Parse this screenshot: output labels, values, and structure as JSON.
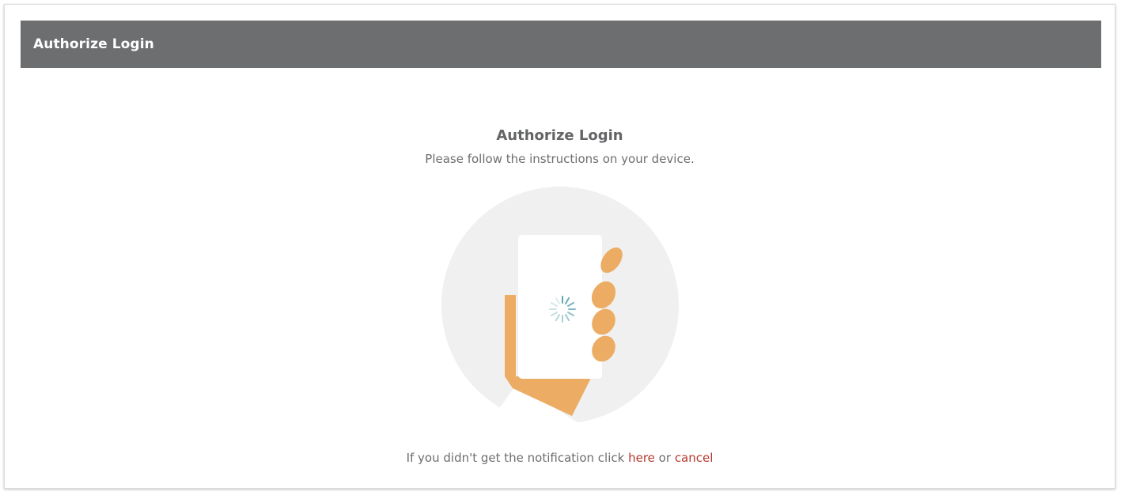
{
  "header": {
    "title": "Authorize Login"
  },
  "main": {
    "title": "Authorize Login",
    "subtitle": "Please follow the instructions on your device.",
    "illustration_icon": "hand-holding-phone-icon",
    "spinner_icon": "loading-spinner-icon"
  },
  "footer": {
    "prefix": "If you didn't get the notification click",
    "here_link": "here",
    "conjunction": "or",
    "cancel_link": "cancel"
  },
  "colors": {
    "header_bg": "#6d6e70",
    "circle_bg": "#f0f0f0",
    "hand": "#ecac64",
    "link": "#b5382c",
    "spinner": "#8cbcc4"
  }
}
